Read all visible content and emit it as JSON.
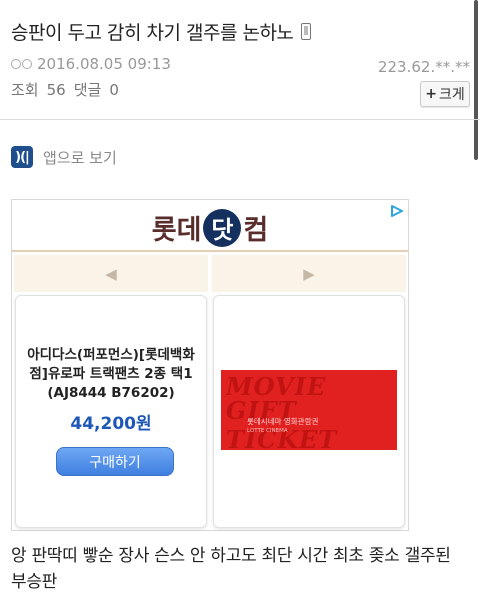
{
  "post": {
    "title": "승판이 두고 감히 차기 갤주를 논하노",
    "date": "2016.08.05 09:13",
    "ip": "223.62.**.**",
    "views_label": "조회",
    "views": "56",
    "comments_label": "댓글",
    "comments": "0",
    "zoom_button": "크게",
    "zoom_plus": "+",
    "body": "앙 판딱띠 빻순 장사 슨스 안 하고도 최단 시간 최초 좆소 갤주된 부승판"
  },
  "app_link": {
    "label": "앱으로 보기",
    "icon_text": ")(|"
  },
  "ad": {
    "brand_left": "롯데",
    "brand_mid": "닷",
    "brand_right": "컴",
    "nav_prev": "◀",
    "nav_next": "▶",
    "product_name": "아디다스(퍼포먼스)[롯데백화점]유로파 트랙팬츠 2종 택1 (AJ8444 B76202)",
    "price": "44,200원",
    "buy_label": "구매하기",
    "ticket_line1": "MOVIE",
    "ticket_line2": "GIFT TICKET",
    "ticket_sub": "롯데시네마 영화관람권",
    "ticket_sub2": "LOTTE CINEMA",
    "colors": {
      "brand": "#5a2d2d",
      "price": "#1e58b7",
      "ticket": "#e12020"
    }
  }
}
